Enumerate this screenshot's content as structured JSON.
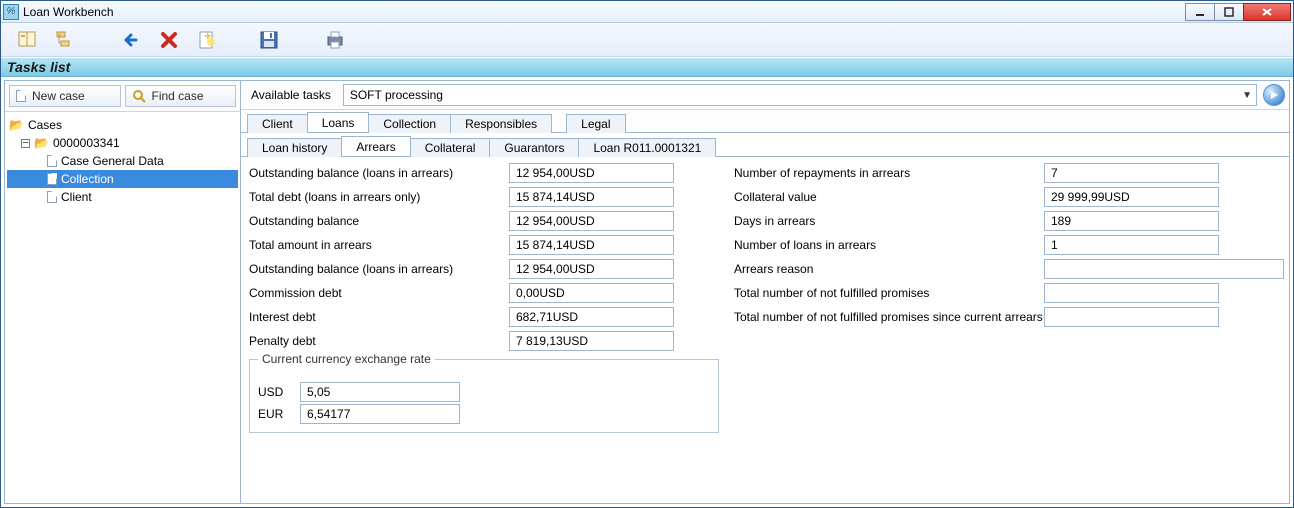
{
  "window": {
    "title": "Loan Workbench"
  },
  "listHeader": "Tasks list",
  "left": {
    "newCase": "New case",
    "findCase": "Find case",
    "tree": {
      "root": "Cases",
      "case": "0000003341",
      "nodes": [
        "Case General Data",
        "Collection",
        "Client"
      ],
      "selectedIndex": 1
    }
  },
  "taskbar": {
    "label": "Available tasks",
    "selected": "SOFT processing"
  },
  "tabs1": {
    "items": [
      "Client",
      "Loans",
      "Collection",
      "Responsibles",
      "Legal"
    ],
    "gapAfter": 3,
    "activeIndex": 1
  },
  "tabs2": {
    "items": [
      "Loan history",
      "Arrears",
      "Collateral",
      "Guarantors",
      "Loan R011.0001321"
    ],
    "activeIndex": 1
  },
  "arrears": {
    "leftLabels": [
      "Outstanding balance (loans in arrears)",
      "Total debt (loans in arrears only)",
      "Outstanding balance",
      "Total amount in arrears",
      "Outstanding balance (loans in arrears)",
      "Commission debt",
      "Interest debt",
      "Penalty debt"
    ],
    "leftValues": [
      "12 954,00USD",
      "15 874,14USD",
      "12 954,00USD",
      "15 874,14USD",
      "12 954,00USD",
      "0,00USD",
      "682,71USD",
      "7 819,13USD"
    ],
    "rightLabels": [
      "Number of repayments in arrears",
      "Collateral value",
      "Days in arrears",
      "Number of loans in arrears",
      "Arrears reason",
      "Total number of not fulfilled promises",
      "Total number of not fulfilled promises since current arrears"
    ],
    "rightValues": [
      "7",
      "29 999,99USD",
      "189",
      "1",
      "",
      "",
      ""
    ]
  },
  "fx": {
    "legend": "Current currency exchange rate",
    "rows": [
      {
        "label": "USD",
        "value": "5,05"
      },
      {
        "label": "EUR",
        "value": "6,54177"
      }
    ]
  }
}
